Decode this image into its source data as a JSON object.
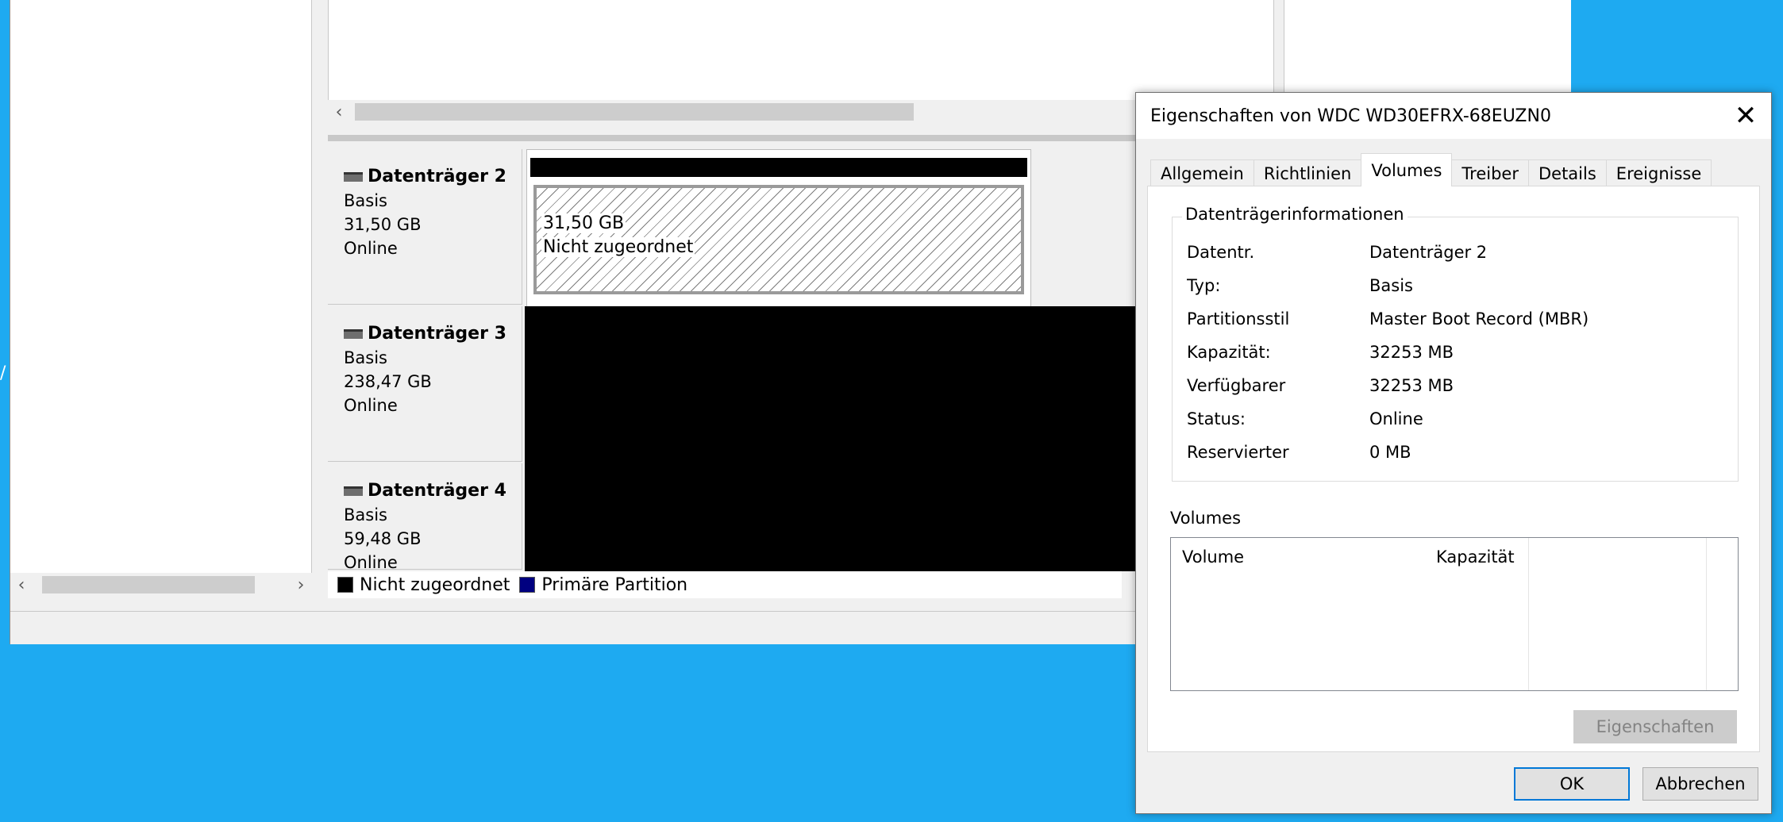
{
  "desktop": {
    "edge_char": "/"
  },
  "legend": [
    {
      "label": "Nicht zugeordnet",
      "color": "#000000"
    },
    {
      "label": "Primäre Partition",
      "color": "#000080"
    }
  ],
  "disks": [
    {
      "name": "Datenträger 2",
      "type": "Basis",
      "size": "31,50 GB",
      "status": "Online",
      "volume": {
        "size": "31,50 GB",
        "label": "Nicht zugeordnet"
      }
    },
    {
      "name": "Datenträger 3",
      "type": "Basis",
      "size": "238,47 GB",
      "status": "Online"
    },
    {
      "name": "Datenträger 4",
      "type": "Basis",
      "size": "59,48 GB",
      "status": "Online"
    }
  ],
  "dialog": {
    "title": "Eigenschaften von WDC WD30EFRX-68EUZN0",
    "tabs": [
      "Allgemein",
      "Richtlinien",
      "Volumes",
      "Treiber",
      "Details",
      "Ereignisse"
    ],
    "active_tab": "Volumes",
    "group_title": "Datenträgerinformationen",
    "info": [
      {
        "key": "Datentr.",
        "value": "Datenträger 2"
      },
      {
        "key": "Typ:",
        "value": "Basis"
      },
      {
        "key": "Partitionsstil",
        "value": "Master Boot Record (MBR)"
      },
      {
        "key": "Kapazität:",
        "value": "32253 MB"
      },
      {
        "key": "Verfügbarer",
        "value": "32253 MB"
      },
      {
        "key": "Status:",
        "value": "Online"
      },
      {
        "key": "Reservierter",
        "value": "0 MB"
      }
    ],
    "volumes_label": "Volumes",
    "volumes_columns": [
      "Volume",
      "Kapazität"
    ],
    "properties_button": "Eigenschaften",
    "ok_button": "OK",
    "cancel_button": "Abbrechen"
  }
}
